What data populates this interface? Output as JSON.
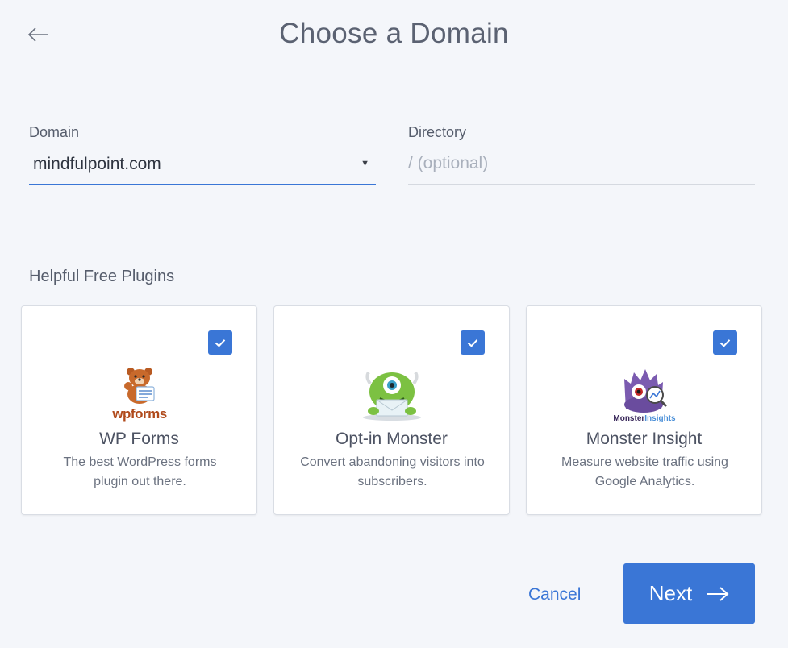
{
  "header": {
    "title": "Choose a Domain",
    "back_icon": "arrow-left-icon"
  },
  "domain": {
    "label": "Domain",
    "selected_value": "mindfulpoint.com",
    "caret_icon": "caret-down-icon"
  },
  "directory": {
    "label": "Directory",
    "value": "",
    "placeholder": "/ (optional)"
  },
  "plugins": {
    "heading": "Helpful Free Plugins",
    "items": [
      {
        "name": "WP Forms",
        "description": "The best WordPress forms plugin out there.",
        "logo_text": "wpforms",
        "checked": true
      },
      {
        "name": "Opt-in Monster",
        "description": "Convert abandoning visitors into subscribers.",
        "checked": true
      },
      {
        "name": "Monster Insight",
        "description": "Measure website traffic using Google Analytics.",
        "logo_text_1": "Monster",
        "logo_text_2": "Insights",
        "checked": true
      }
    ]
  },
  "footer": {
    "cancel_label": "Cancel",
    "next_label": "Next",
    "next_icon": "arrow-right-icon"
  },
  "colors": {
    "accent": "#3a76d6",
    "background": "#f4f6fa",
    "card_border": "#d9dde4"
  }
}
